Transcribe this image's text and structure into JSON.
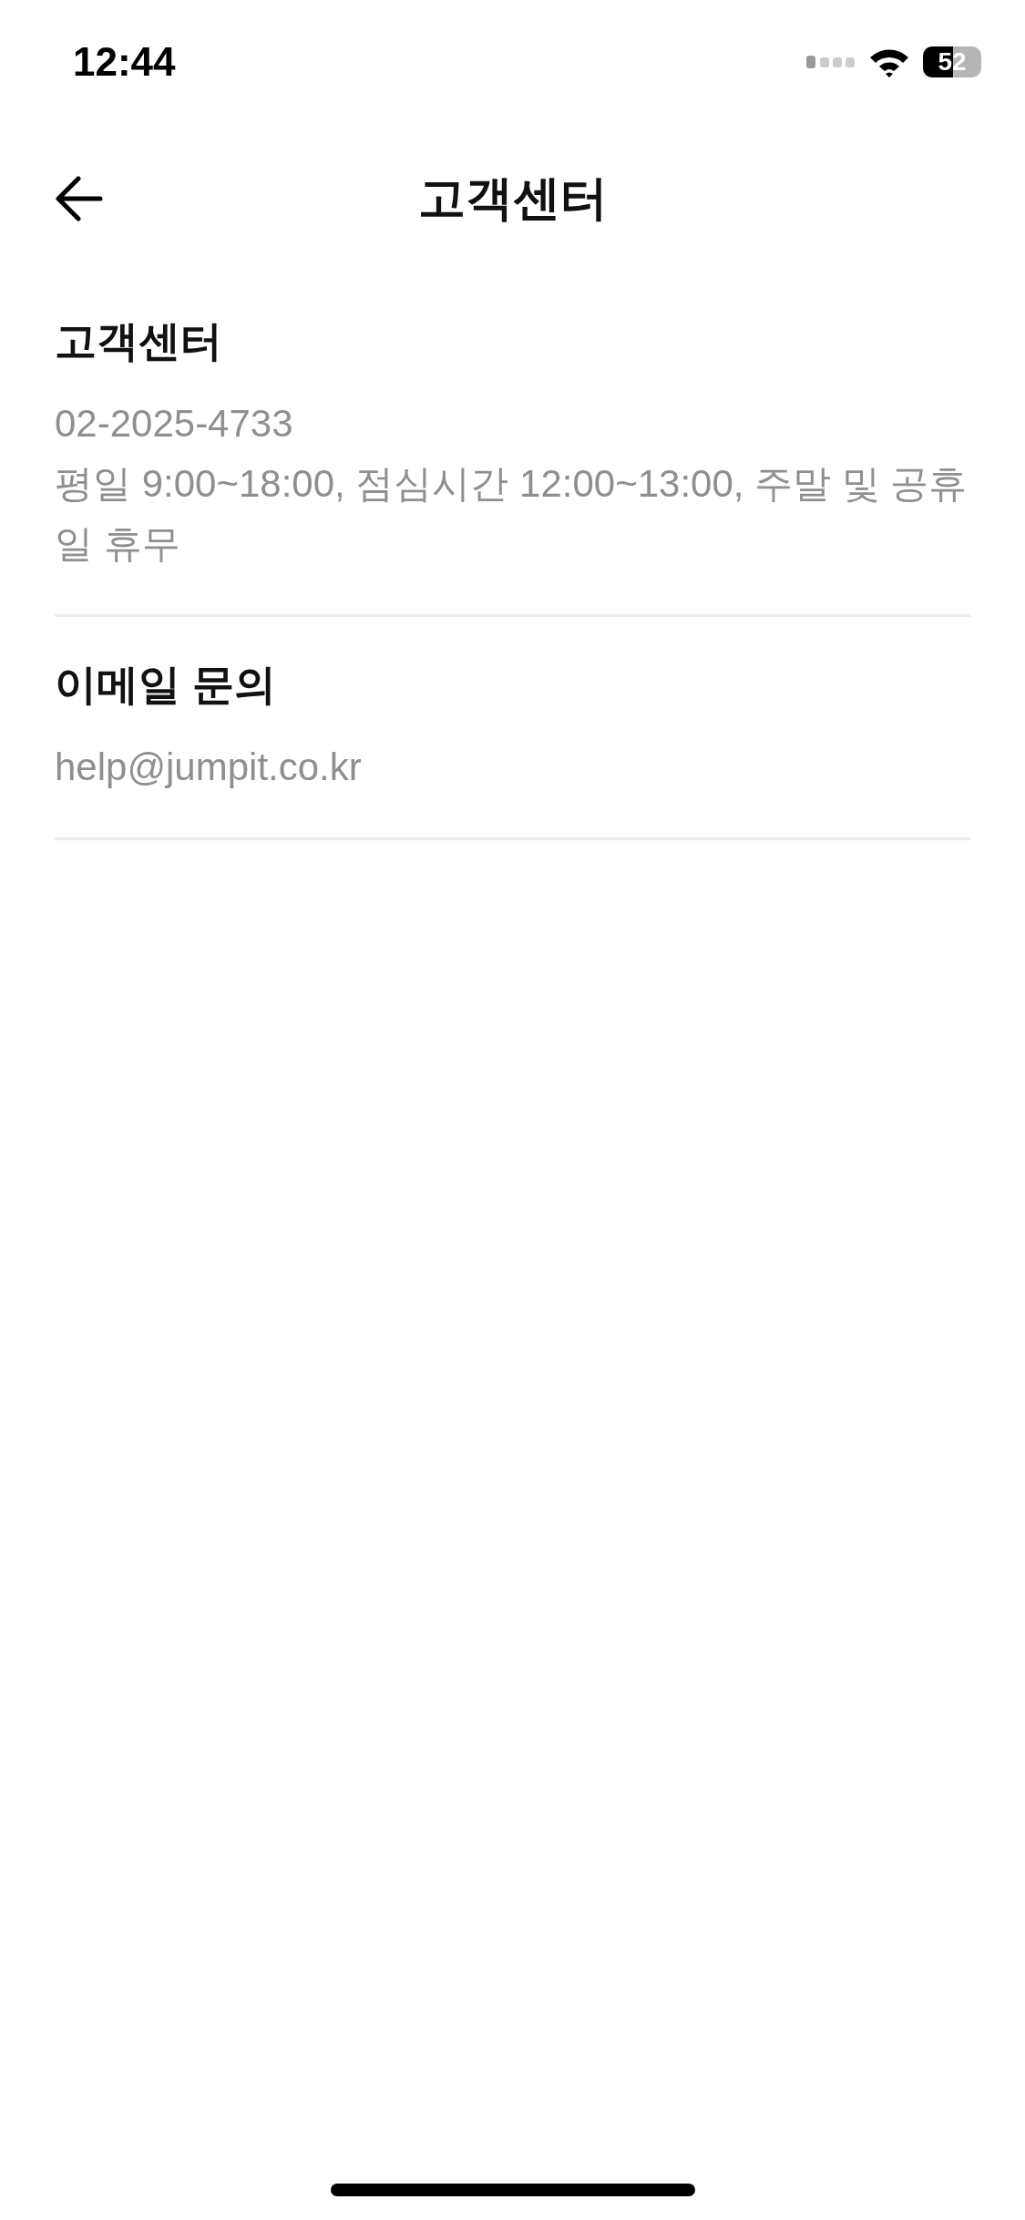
{
  "status_bar": {
    "time": "12:44",
    "battery": "52"
  },
  "header": {
    "title": "고객센터"
  },
  "sections": [
    {
      "title": "고객센터",
      "lines": [
        "02-2025-4733",
        "평일 9:00~18:00, 점심시간 12:00~13:00, 주말 및 공휴일 휴무"
      ]
    },
    {
      "title": "이메일 문의",
      "lines": [
        "help@jumpit.co.kr"
      ]
    }
  ]
}
